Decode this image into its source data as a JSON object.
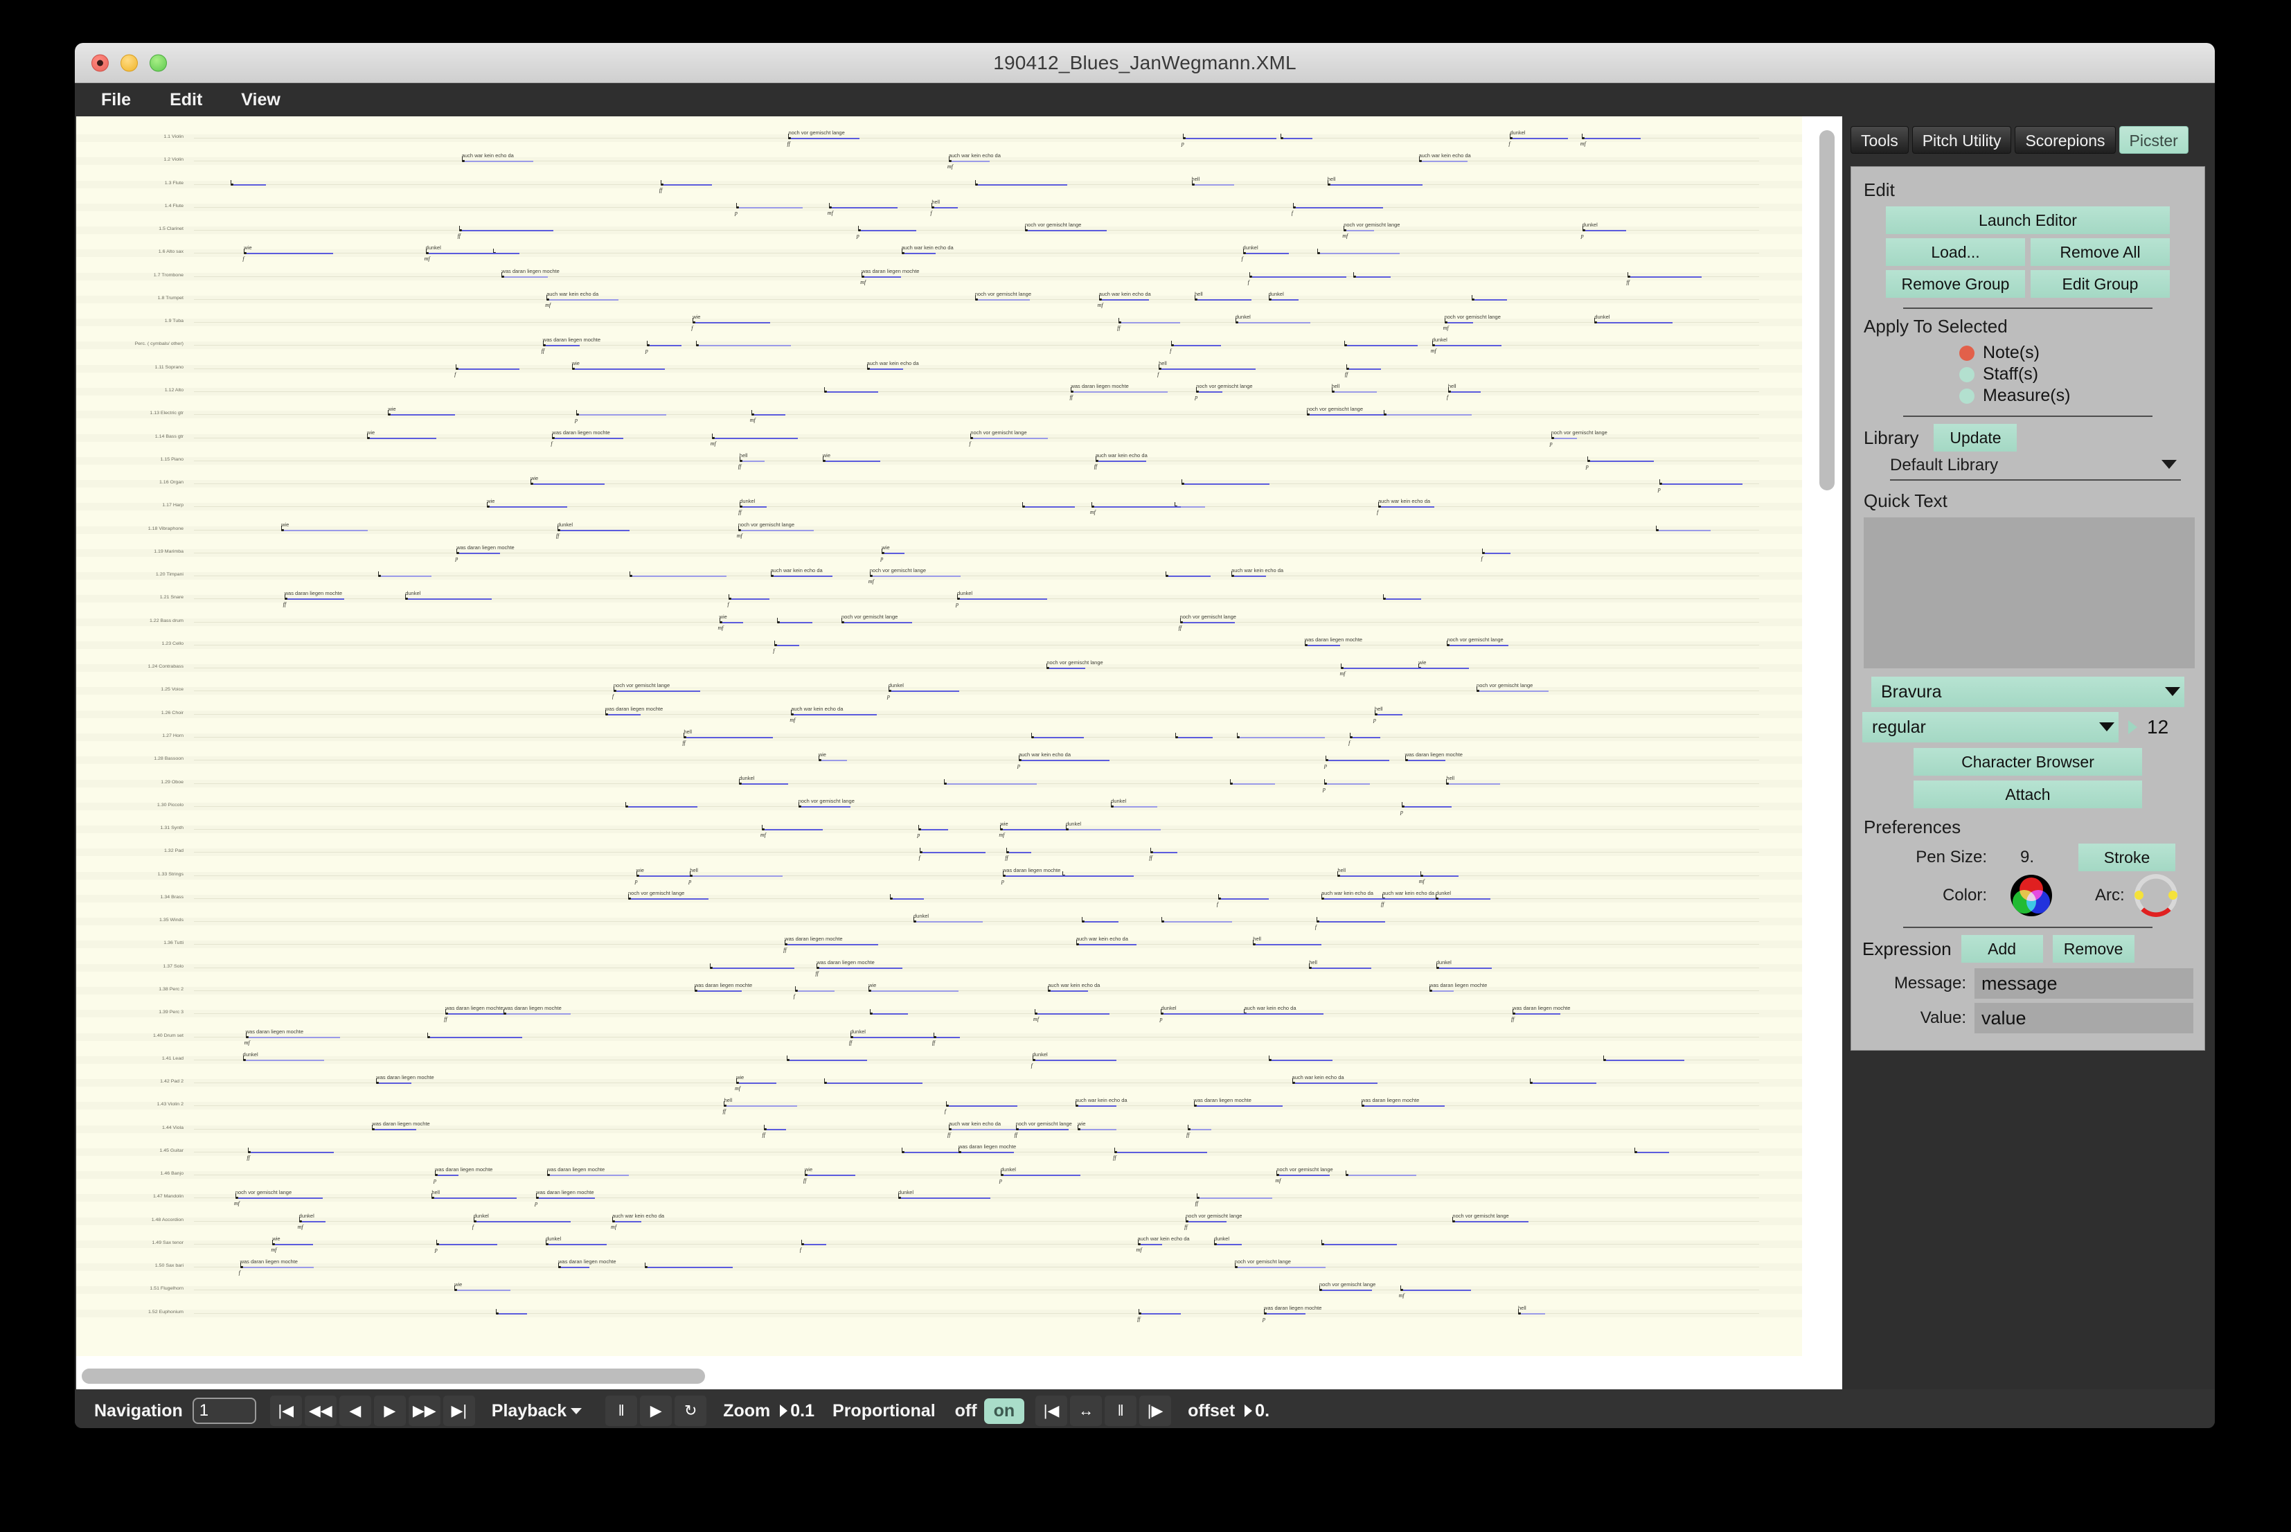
{
  "window": {
    "title": "190412_Blues_JanWegmann.XML",
    "traffic_lights": [
      "close",
      "minimize",
      "maximize"
    ]
  },
  "menubar": {
    "items": [
      {
        "label": "File"
      },
      {
        "label": "Edit"
      },
      {
        "label": "View"
      }
    ]
  },
  "panel": {
    "tabs": [
      {
        "label": "Tools",
        "active": false
      },
      {
        "label": "Pitch Utility",
        "active": false
      },
      {
        "label": "Scorepions",
        "active": false
      },
      {
        "label": "Picster",
        "active": true
      }
    ],
    "edit": {
      "title": "Edit",
      "launch_editor": "Launch Editor",
      "load": "Load...",
      "remove_all": "Remove All",
      "remove_group": "Remove Group",
      "edit_group": "Edit Group"
    },
    "apply_to_selected": {
      "title": "Apply To Selected",
      "options": [
        {
          "label": "Note(s)",
          "selected": true
        },
        {
          "label": "Staff(s)",
          "selected": false
        },
        {
          "label": "Measure(s)",
          "selected": false
        }
      ]
    },
    "library": {
      "title": "Library",
      "update_label": "Update",
      "selected": "Default Library"
    },
    "quick_text": {
      "title": "Quick Text",
      "content": ""
    },
    "font": {
      "family": "Bravura",
      "weight": "regular",
      "size": "12",
      "character_browser": "Character Browser",
      "attach": "Attach"
    },
    "preferences": {
      "title": "Preferences",
      "pen_size_label": "Pen Size:",
      "pen_size_value": "9.",
      "stroke_label": "Stroke",
      "color_label": "Color:",
      "arc_label": "Arc:"
    },
    "expression": {
      "title": "Expression",
      "add_label": "Add",
      "remove_label": "Remove",
      "message_label": "Message:",
      "message_value": "message",
      "value_label": "Value:",
      "value_value": "value"
    }
  },
  "bottombar": {
    "navigation_label": "Navigation",
    "navigation_value": "1",
    "transport": [
      {
        "name": "go-to-start-icon",
        "glyph": "|◀"
      },
      {
        "name": "rewind-icon",
        "glyph": "◀◀"
      },
      {
        "name": "step-back-icon",
        "glyph": "◀"
      },
      {
        "name": "step-forward-icon",
        "glyph": "▶"
      },
      {
        "name": "fast-forward-icon",
        "glyph": "▶▶"
      },
      {
        "name": "go-to-end-icon",
        "glyph": "▶|"
      }
    ],
    "playback_label": "Playback",
    "playback_buttons": [
      {
        "name": "pause-icon",
        "glyph": "‖"
      },
      {
        "name": "play-icon",
        "glyph": "▶"
      },
      {
        "name": "loop-icon",
        "glyph": "↻"
      }
    ],
    "zoom_label": "Zoom",
    "zoom_value": "0.1",
    "proportional_label": "Proportional",
    "proportional_off": "off",
    "proportional_on": "on",
    "align_buttons": [
      {
        "name": "align-start-icon",
        "glyph": "|◀"
      },
      {
        "name": "align-spread-icon",
        "glyph": "↔"
      },
      {
        "name": "align-split-icon",
        "glyph": "‖"
      },
      {
        "name": "align-end-icon",
        "glyph": "|▶"
      }
    ],
    "offset_label": "offset",
    "offset_value": "0."
  },
  "colors": {
    "mint": "#a9ddc9",
    "panel_bg": "#bdbdbd",
    "chrome_dark": "#2f2f2f",
    "score_paper": "#fcfcea",
    "duration_line": "#5b5bdd",
    "note_selected": "#e2604a"
  },
  "score": {
    "staff_labels": [
      "1.1 Violin",
      "1.2 Violin",
      "1.3 Flute",
      "1.4 Flute",
      "1.5 Clarinet",
      "1.6 Alto sax",
      "1.7 Trombone",
      "1.8 Trumpet",
      "1.9 Tuba",
      "Perc. ( cymbals/ other)",
      "1.11 Soprano",
      "1.12 Alto",
      "1.13 Electric gtr",
      "1.14 Bass gtr",
      "1.15 Piano",
      "1.16 Organ",
      "1.17 Harp",
      "1.18 Vibraphone",
      "1.19 Marimba",
      "1.20 Timpani",
      "1.21 Snare",
      "1.22 Bass drum",
      "1.23 Cello",
      "1.24 Contrabass",
      "1.25 Voice",
      "1.26 Choir",
      "1.27 Horn",
      "1.28 Bassoon",
      "1.29 Oboe",
      "1.30 Piccolo",
      "1.31 Synth",
      "1.32 Pad",
      "1.33 Strings",
      "1.34 Brass",
      "1.35 Winds",
      "1.36 Tutti",
      "1.37 Solo",
      "1.38 Perc 2",
      "1.39 Perc 3",
      "1.40 Drum set",
      "1.41 Lead",
      "1.42 Pad 2",
      "1.43 Violin 2",
      "1.44 Viola",
      "1.45 Guitar",
      "1.46 Banjo",
      "1.47 Mandolin",
      "1.48 Accordion",
      "1.49 Sax tenor",
      "1.50 Sax bari",
      "1.51 Flugelhorn",
      "1.52 Euphonium"
    ],
    "lyric_phrases": [
      "hell",
      "auch war kein echo da",
      "wie",
      "noch vor gemischt lange",
      "was daran liegen mochte",
      "dunkel"
    ],
    "dynamic_glyphs": [
      "f",
      "mf",
      "p",
      "ff"
    ]
  }
}
